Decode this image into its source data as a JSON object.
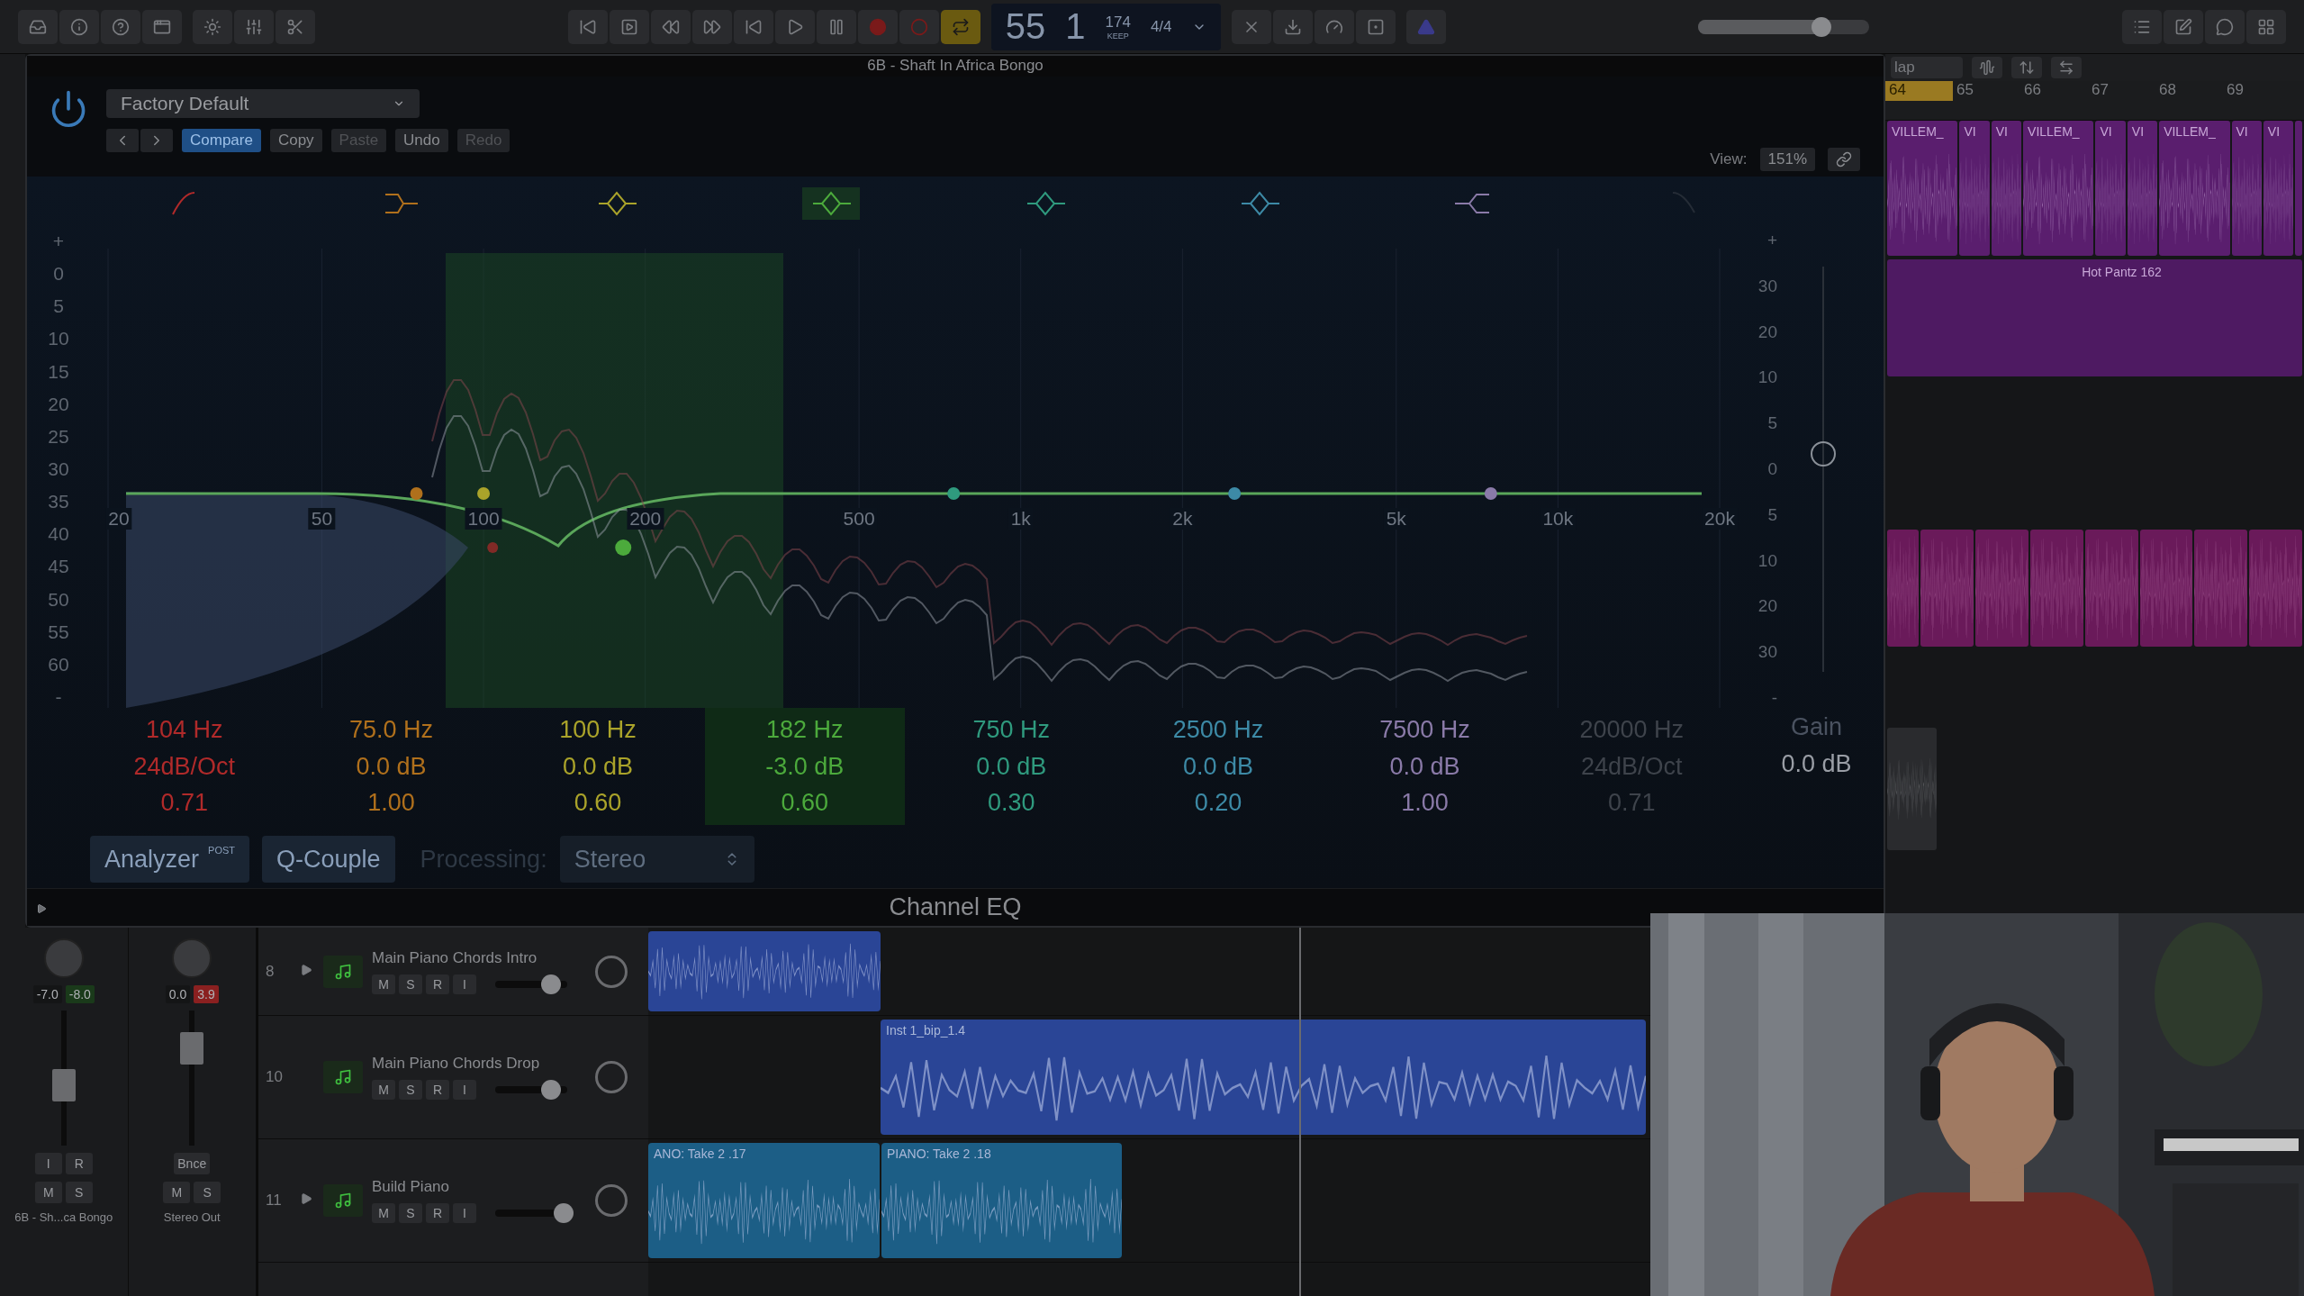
{
  "toolbar": {
    "lcd": {
      "bar": "55",
      "beat": "1",
      "tempo": "174",
      "tempo_mode": "KEEP",
      "signature": "4/4"
    },
    "master_volume": {
      "level": 0.72
    }
  },
  "plugin": {
    "title": "6B - Shaft In Africa Bongo",
    "preset": "Factory Default",
    "buttons": [
      {
        "label": "Compare",
        "selected": true,
        "disabled": false
      },
      {
        "label": "Copy",
        "selected": false,
        "disabled": false
      },
      {
        "label": "Paste",
        "selected": false,
        "disabled": true
      },
      {
        "label": "Undo",
        "selected": false,
        "disabled": false
      },
      {
        "label": "Redo",
        "selected": false,
        "disabled": true
      }
    ],
    "view_label": "View:",
    "view_value": "151%",
    "left_scale": [
      "+",
      "0",
      "5",
      "10",
      "15",
      "20",
      "25",
      "30",
      "35",
      "40",
      "45",
      "50",
      "55",
      "60",
      "-"
    ],
    "right_scale": [
      "+",
      "30",
      "20",
      "10",
      "5",
      "0",
      "5",
      "10",
      "20",
      "30",
      "-"
    ],
    "freq_labels": [
      "20",
      "50",
      "100",
      "200",
      "500",
      "1k",
      "2k",
      "5k",
      "10k",
      "20k"
    ],
    "bands": [
      {
        "kind": "lowcut",
        "on": true,
        "selected": false,
        "color": "#b02a2a",
        "freq": "104 Hz",
        "gain": "24dB/Oct",
        "q": "0.71"
      },
      {
        "kind": "lowshelf",
        "on": true,
        "selected": false,
        "color": "#b0701c",
        "freq": "75.0 Hz",
        "gain": "0.0 dB",
        "q": "1.00"
      },
      {
        "kind": "bell",
        "on": true,
        "selected": false,
        "color": "#aaa32a",
        "freq": "100 Hz",
        "gain": "0.0 dB",
        "q": "0.60"
      },
      {
        "kind": "bell",
        "on": true,
        "selected": true,
        "color": "#4caa3c",
        "freq": "182 Hz",
        "gain": "-3.0 dB",
        "q": "0.60"
      },
      {
        "kind": "bell",
        "on": true,
        "selected": false,
        "color": "#2f9a7e",
        "freq": "750 Hz",
        "gain": "0.0 dB",
        "q": "0.30"
      },
      {
        "kind": "bell",
        "on": true,
        "selected": false,
        "color": "#3d8aa6",
        "freq": "2500 Hz",
        "gain": "0.0 dB",
        "q": "0.20"
      },
      {
        "kind": "highshelf",
        "on": true,
        "selected": false,
        "color": "#8a7aa8",
        "freq": "7500 Hz",
        "gain": "0.0 dB",
        "q": "1.00"
      },
      {
        "kind": "highcut",
        "on": false,
        "selected": false,
        "color": "#3e434b",
        "freq": "20000 Hz",
        "gain": "24dB/Oct",
        "q": "0.71"
      }
    ],
    "gain_label": "Gain",
    "gain_value": "0.0 dB",
    "analyzer": {
      "label": "Analyzer",
      "badge": "POST"
    },
    "q_couple": "Q-Couple",
    "processing": {
      "label": "Processing:",
      "value": "Stereo",
      "disabled": true
    },
    "footer": "Channel EQ"
  },
  "arrange": {
    "snap": "lap",
    "ruler": [
      {
        "label": "64",
        "selected": true
      },
      {
        "label": "65",
        "selected": false
      },
      {
        "label": "66",
        "selected": false
      },
      {
        "label": "67",
        "selected": false
      },
      {
        "label": "68",
        "selected": false
      },
      {
        "label": "69",
        "selected": false
      }
    ],
    "top_regions": [
      "VILLEM_",
      "VI",
      "VI",
      "VILLEM_",
      "VI",
      "VI",
      "VILLEM_",
      "VI",
      "VI"
    ],
    "long_region": "Hot Pantz 162"
  },
  "mixer": [
    {
      "values": [
        "-7.0",
        "-8.0"
      ],
      "peak_over": false,
      "level": 0.45,
      "buttons": [
        "I",
        "R"
      ],
      "mute": "M",
      "solo": "S",
      "name": "6B - Sh...ca Bongo"
    },
    {
      "values": [
        "0.0",
        "3.9"
      ],
      "peak_over": true,
      "level": 0.72,
      "buttons": [
        "Bnce"
      ],
      "mute": "M",
      "solo": "S",
      "name": "Stereo Out"
    }
  ],
  "tracks": [
    {
      "number": "8",
      "name": "Main Piano Chords Intro",
      "disclosure": true,
      "buttons": [
        "M",
        "S",
        "R",
        "I"
      ],
      "volume": {
        "level": 0.78
      },
      "regions": [
        {
          "color": "#2a4596"
        }
      ]
    },
    {
      "number": "10",
      "name": "Main Piano Chords Drop",
      "disclosure": false,
      "buttons": [
        "M",
        "S",
        "R",
        "I"
      ],
      "volume": {
        "level": 0.78
      },
      "regions": [
        {
          "label": "Inst 1_bip_1.4",
          "color": "#2a4596"
        }
      ]
    },
    {
      "number": "11",
      "name": "Build Piano",
      "disclosure": true,
      "buttons": [
        "M",
        "S",
        "R",
        "I"
      ],
      "volume": {
        "level": 0.95
      },
      "regions": [
        {
          "label": "ANO: Take 2 .17",
          "color": "#1c5e86"
        },
        {
          "label": "PIANO: Take 2 .18",
          "color": "#1c5e86"
        }
      ]
    }
  ]
}
